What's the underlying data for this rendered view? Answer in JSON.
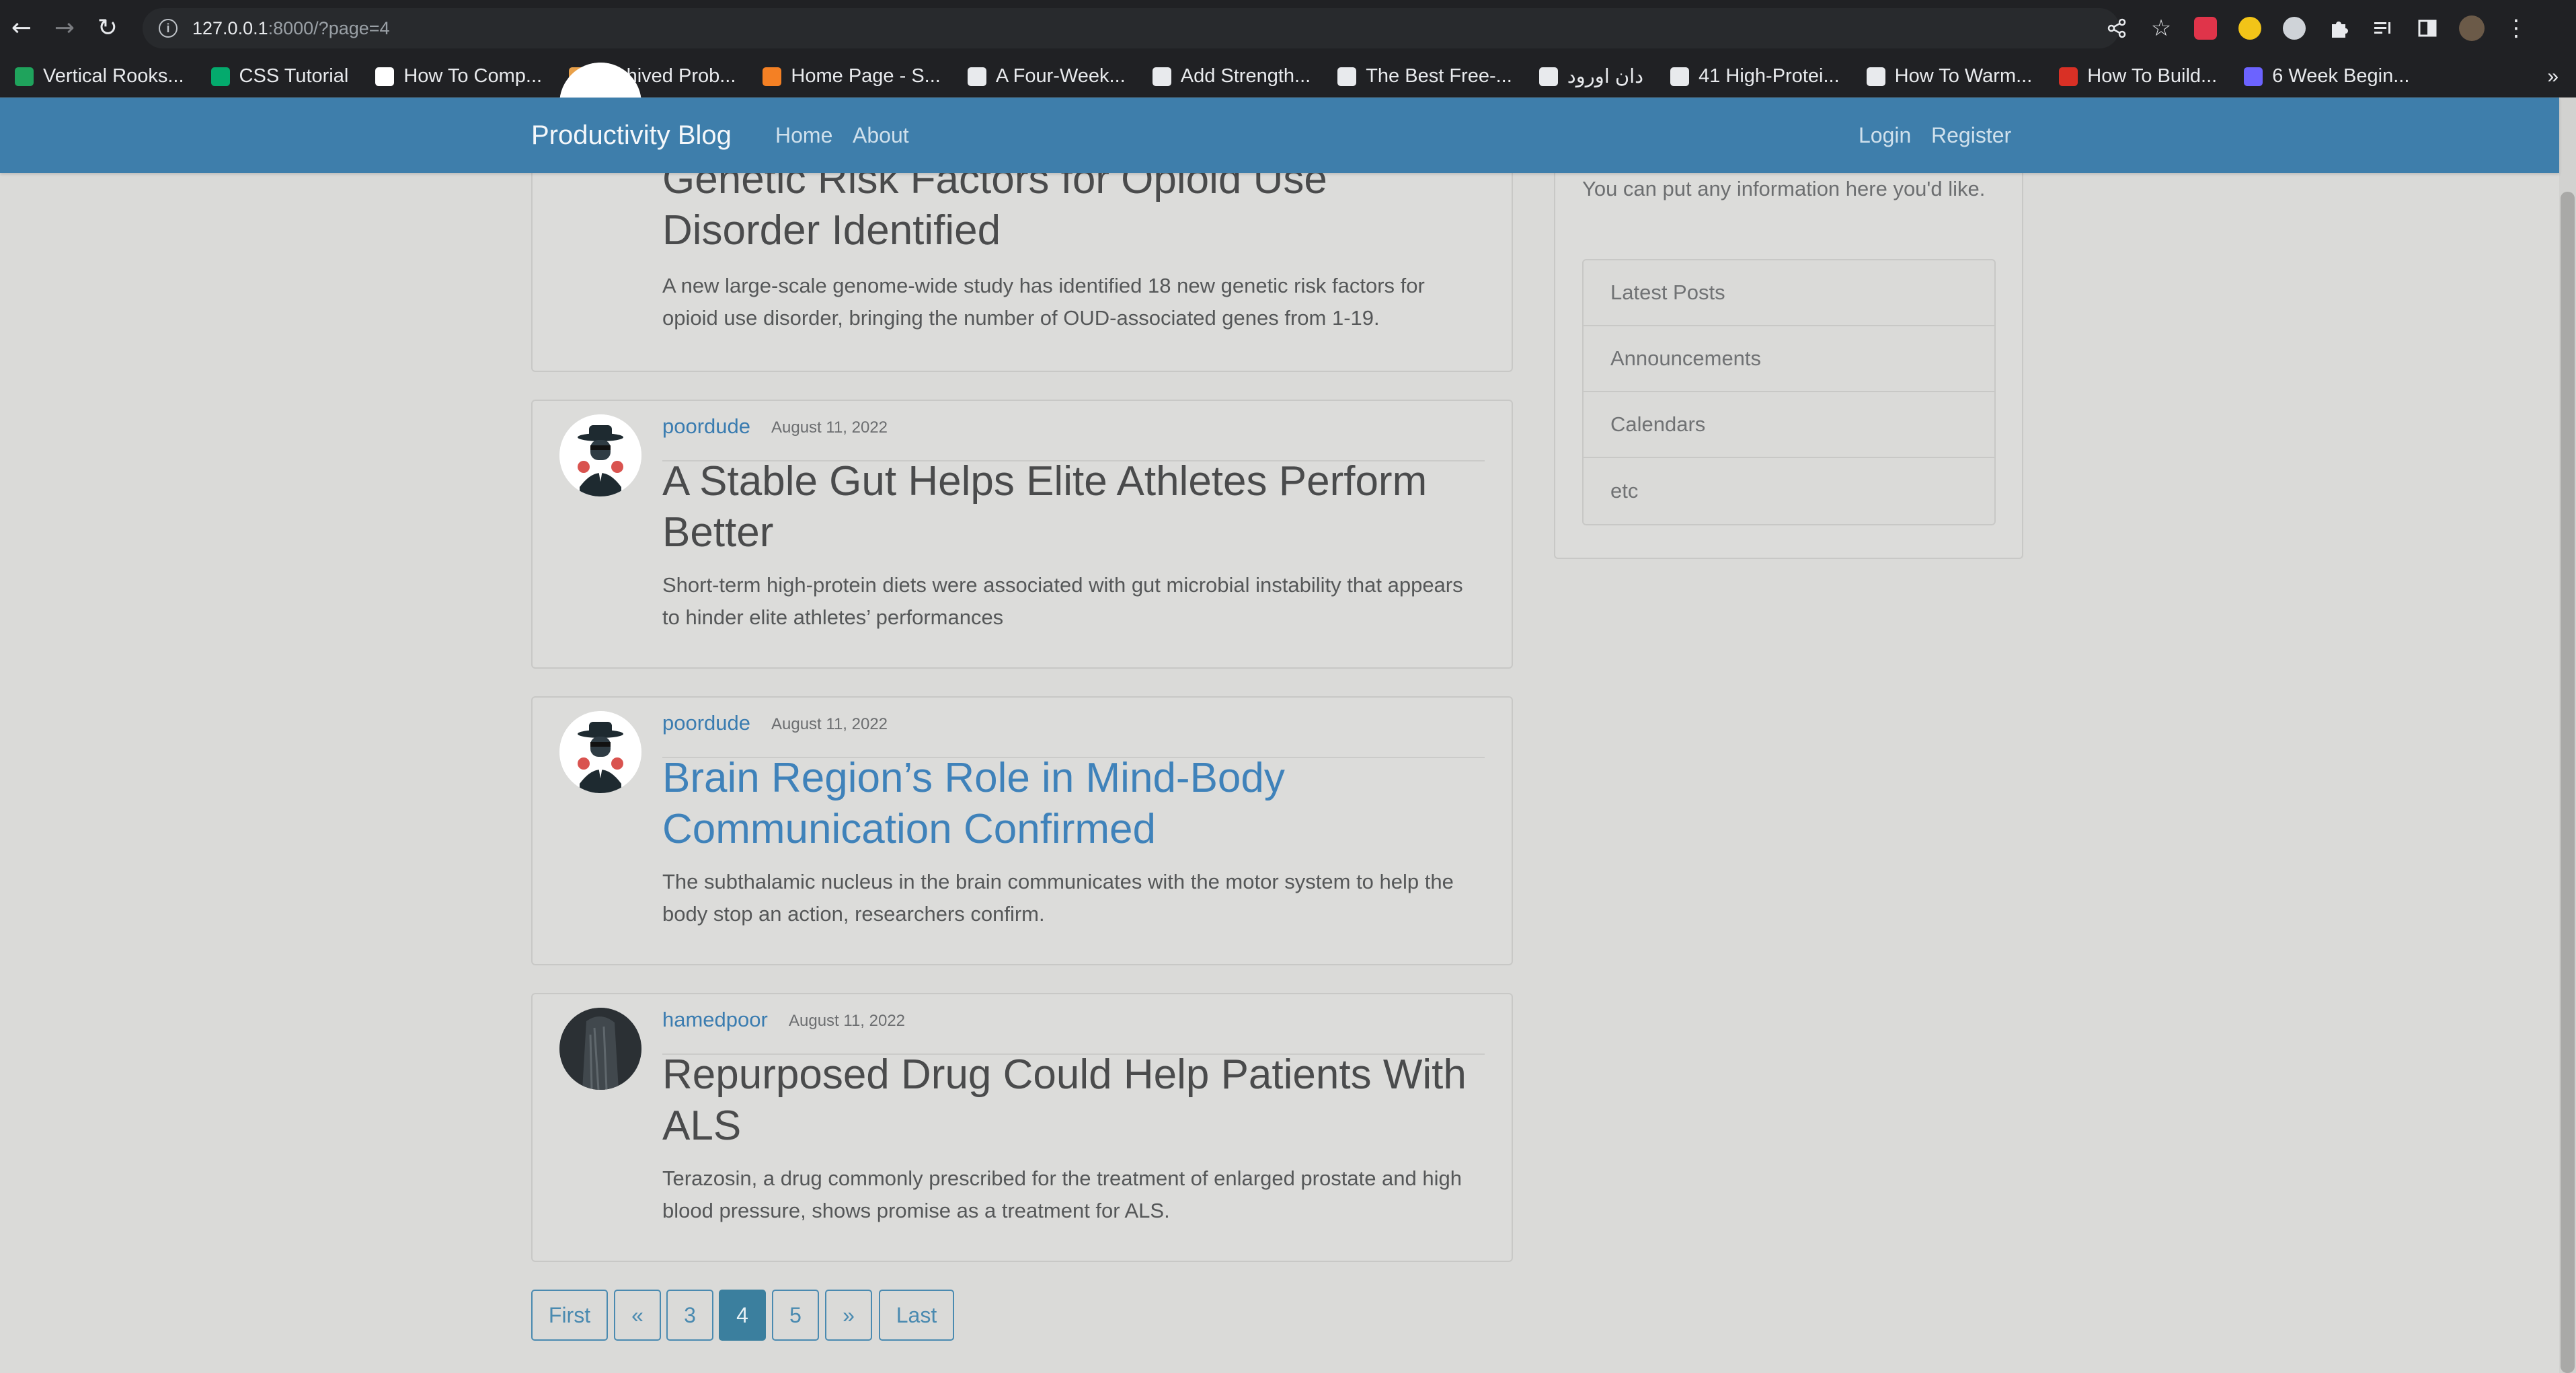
{
  "browser": {
    "url_host": "127.0.0.1",
    "url_path": ":8000/?page=4",
    "bookmarks": [
      {
        "label": "Vertical Rooks...",
        "icon": "dot-chart-icon",
        "color": "#1fa35c"
      },
      {
        "label": "CSS Tutorial",
        "icon": "w3schools-icon",
        "color": "#04aa6d"
      },
      {
        "label": "How To Comp...",
        "icon": "medium-icon",
        "color": "#ffffff"
      },
      {
        "label": "Archived Prob...",
        "icon": "project-euler-icon",
        "color": "#e8a04a"
      },
      {
        "label": "Home Page - S...",
        "icon": "stackexchange-icon",
        "color": "#f48024"
      },
      {
        "label": "A Four-Week...",
        "icon": "c-letter-icon",
        "color": "#e8eaed"
      },
      {
        "label": "Add Strength...",
        "icon": "c-letter-icon",
        "color": "#e8eaed"
      },
      {
        "label": "The Best Free-...",
        "icon": "c-letter-icon",
        "color": "#e8eaed"
      },
      {
        "label": "دان اورود",
        "icon": "globe-icon",
        "color": "#e8eaed"
      },
      {
        "label": "41 High-Protei...",
        "icon": "c-letter-icon",
        "color": "#e8eaed"
      },
      {
        "label": "How To Warm...",
        "icon": "c-letter-icon",
        "color": "#e8eaed"
      },
      {
        "label": "How To Build...",
        "icon": "red-swirl-icon",
        "color": "#d93025"
      },
      {
        "label": "6 Week Begin...",
        "icon": "runner-icon",
        "color": "#6c63ff"
      }
    ]
  },
  "site": {
    "brand": "Productivity Blog",
    "nav_home": "Home",
    "nav_about": "About",
    "nav_login": "Login",
    "nav_register": "Register",
    "navbar_color": "#3e7eab"
  },
  "posts": [
    {
      "author": "",
      "date": "",
      "title": "Genetic Risk Factors for Opioid Use Disorder Identified",
      "excerpt": "A new large-scale genome-wide study has identified 18 new genetic risk factors for opioid use disorder, bringing the number of OUD-associated genes from 1-19."
    },
    {
      "author": "poordude",
      "date": "August 11, 2022",
      "title": "A Stable Gut Helps Elite Athletes Perform Better",
      "excerpt": "Short-term high-protein diets were associated with gut microbial instability that appears to hinder elite athletes’ performances"
    },
    {
      "author": "poordude",
      "date": "August 11, 2022",
      "title": "Brain Region’s Role in Mind-Body Communication Confirmed",
      "excerpt": "The subthalamic nucleus in the brain communicates with the motor system to help the body stop an action, researchers confirm."
    },
    {
      "author": "hamedpoor",
      "date": "August 11, 2022",
      "title": "Repurposed Drug Could Help Patients With ALS",
      "excerpt": "Terazosin, a drug commonly prescribed for the treatment of enlarged prostate and high blood pressure, shows promise as a treatment for ALS."
    }
  ],
  "sidebar": {
    "text": "You can put any information here you'd like.",
    "items": [
      "Latest Posts",
      "Announcements",
      "Calendars",
      "etc"
    ]
  },
  "pagination": {
    "first": "First",
    "prev": "«",
    "pages": [
      "3",
      "4",
      "5"
    ],
    "current": "4",
    "next": "»",
    "last": "Last"
  }
}
